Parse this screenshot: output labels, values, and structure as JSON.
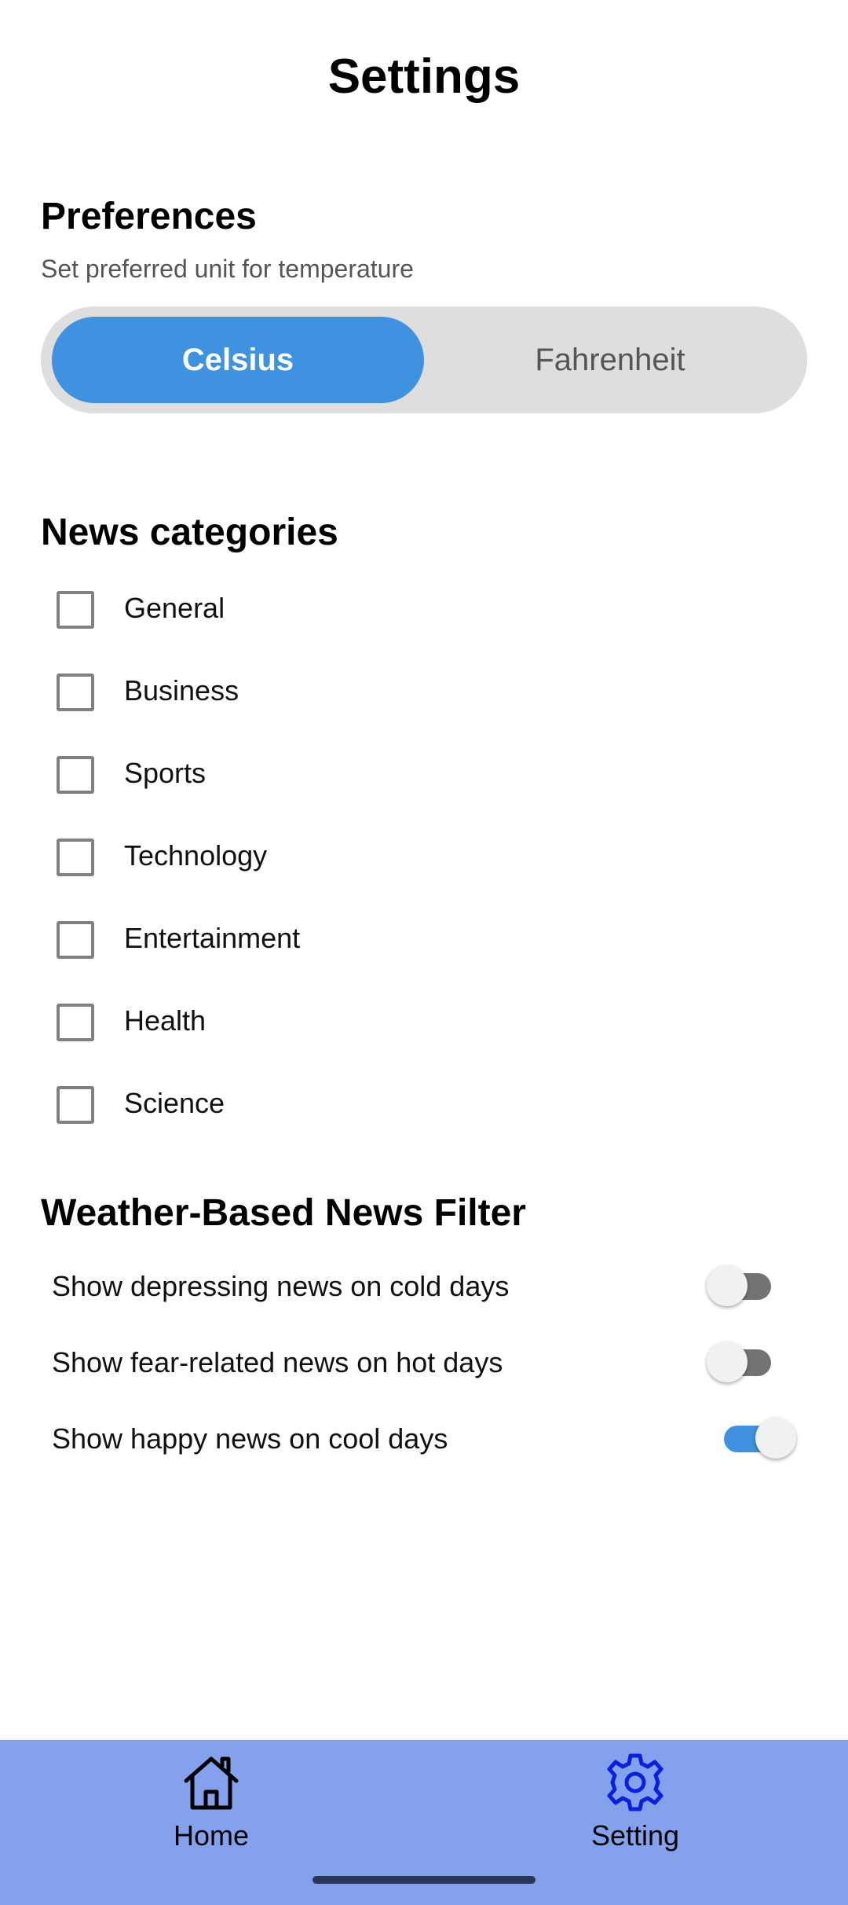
{
  "header": {
    "title": "Settings"
  },
  "preferences": {
    "title": "Preferences",
    "subtitle": "Set preferred unit for temperature",
    "options": [
      "Celsius",
      "Fahrenheit"
    ],
    "selected": "Celsius"
  },
  "news_categories": {
    "title": "News categories",
    "items": [
      {
        "label": "General",
        "checked": false
      },
      {
        "label": "Business",
        "checked": false
      },
      {
        "label": "Sports",
        "checked": false
      },
      {
        "label": "Technology",
        "checked": false
      },
      {
        "label": "Entertainment",
        "checked": false
      },
      {
        "label": "Health",
        "checked": false
      },
      {
        "label": "Science",
        "checked": false
      }
    ]
  },
  "weather_filter": {
    "title": "Weather-Based News Filter",
    "items": [
      {
        "label": "Show depressing news on cold days",
        "enabled": false
      },
      {
        "label": "Show fear-related news on hot days",
        "enabled": false
      },
      {
        "label": "Show happy news on cool days",
        "enabled": true
      }
    ]
  },
  "bottom_nav": {
    "items": [
      {
        "label": "Home",
        "icon": "home-icon"
      },
      {
        "label": "Setting",
        "icon": "gear-icon"
      }
    ],
    "active": "Setting"
  },
  "colors": {
    "accent": "#3f92df",
    "nav_background": "#84a1ec",
    "active_nav_icon": "#0a1fe0"
  }
}
